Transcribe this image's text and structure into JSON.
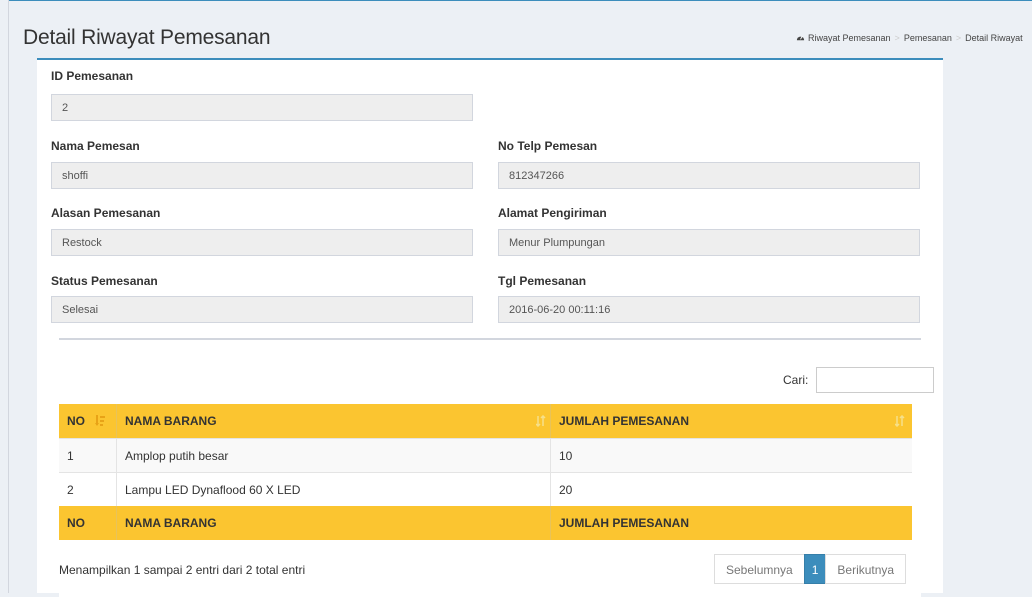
{
  "header": {
    "title": "Detail Riwayat Pemesanan",
    "breadcrumb": [
      "Riwayat Pemesanan",
      "Pemesanan",
      "Detail Riwayat"
    ]
  },
  "form": {
    "id_label": "ID Pemesanan",
    "id_value": "2",
    "nama_label": "Nama Pemesan",
    "nama_value": "shoffi",
    "telp_label": "No Telp Pemesan",
    "telp_value": "812347266",
    "alasan_label": "Alasan Pemesanan",
    "alasan_value": "Restock",
    "alamat_label": "Alamat Pengiriman",
    "alamat_value": "Menur Plumpungan",
    "status_label": "Status Pemesanan",
    "status_value": "Selesai",
    "tgl_label": "Tgl Pemesanan",
    "tgl_value": "2016-06-20 00:11:16"
  },
  "table": {
    "search_label": "Cari:",
    "columns": [
      "NO",
      "NAMA BARANG",
      "JUMLAH PEMESANAN"
    ],
    "rows": [
      [
        "1",
        "Amplop putih besar",
        "10"
      ],
      [
        "2",
        "Lampu LED Dynaflood 60 X LED",
        "20"
      ]
    ],
    "info": "Menampilkan 1 sampai 2 entri dari 2 total entri",
    "pagination": {
      "prev": "Sebelumnya",
      "current": "1",
      "next": "Berikutnya"
    }
  },
  "colors": {
    "accent": "#3c8dbc",
    "table_header": "#fbc530"
  }
}
